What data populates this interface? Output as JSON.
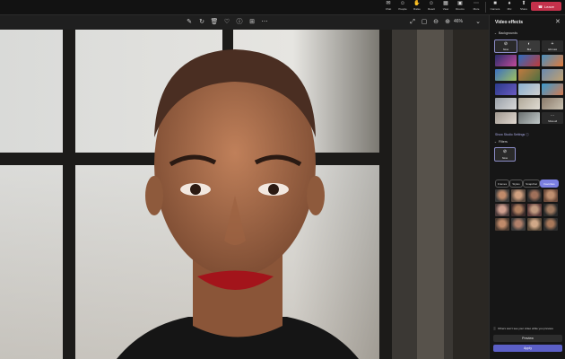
{
  "topbar": {
    "items": [
      {
        "label": "Chat",
        "icon": "chat-icon",
        "glyph": "✉"
      },
      {
        "label": "People",
        "icon": "people-icon",
        "glyph": "☺"
      },
      {
        "label": "Raise",
        "icon": "raise-hand-icon",
        "glyph": "✋"
      },
      {
        "label": "React",
        "icon": "react-icon",
        "glyph": "☺"
      },
      {
        "label": "View",
        "icon": "view-icon",
        "glyph": "▦"
      },
      {
        "label": "Rooms",
        "icon": "rooms-icon",
        "glyph": "▣"
      },
      {
        "label": "More",
        "icon": "more-icon",
        "glyph": "⋯"
      },
      {
        "label": "Camera",
        "icon": "camera-icon",
        "glyph": "■"
      },
      {
        "label": "Mic",
        "icon": "mic-icon",
        "glyph": "♦"
      },
      {
        "label": "Share",
        "icon": "share-icon",
        "glyph": "⬆"
      }
    ],
    "leave_label": "Leave",
    "leave_color": "#c4314b"
  },
  "toolbar": {
    "zoom": "46%"
  },
  "panel": {
    "title": "Video effects",
    "backgrounds_heading": "Backgrounds",
    "bg_tiles": [
      {
        "label": "None",
        "icon": "none-icon",
        "glyph": "⊘"
      },
      {
        "label": "Blur",
        "icon": "blur-icon",
        "glyph": "◐"
      },
      {
        "label": "Add new",
        "icon": "add-new-icon",
        "glyph": "+"
      },
      {
        "label": "Show all",
        "icon": "show-all-icon",
        "glyph": "⋯"
      }
    ],
    "studio_link": "Show Studio Settings",
    "filters_heading": "Filters",
    "filters_none_label": "None",
    "filter_tabs": [
      "Frames",
      "Styles",
      "Snapchat",
      "Favorites"
    ],
    "notice": "Others won't see your video while you preview.",
    "preview_label": "Preview",
    "apply_label": "Apply",
    "accent": "#5b5fc7"
  }
}
